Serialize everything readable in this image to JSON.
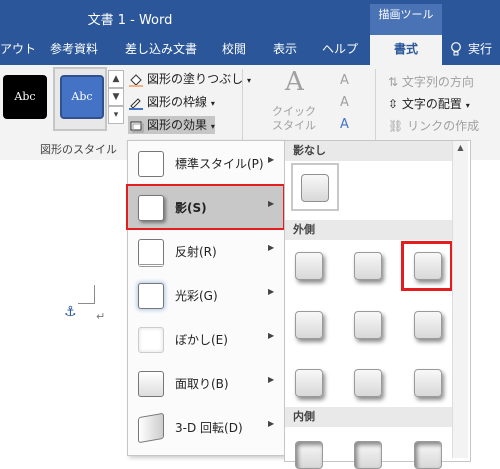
{
  "titlebar": {
    "title": "文書 1  -  Word",
    "tools_label": "描画ツール"
  },
  "tabs": [
    "アウト",
    "参考資料",
    "差し込み文書",
    "校閲",
    "表示",
    "ヘルプ",
    "書式",
    "実行"
  ],
  "ribbon": {
    "swatch_text": "Abc",
    "swatch_text2": "Abc",
    "cmd_fill": "図形の塗りつぶし",
    "cmd_outline": "図形の枠線",
    "cmd_effects": "図形の効果",
    "group_label": "図形のスタイル",
    "quick_style": "クイック\nスタイル",
    "text_direction": "文字列の方向",
    "text_align": "文字の配置",
    "create_link": "リンクの作成",
    "wordart_a": "A"
  },
  "menu": {
    "items": [
      {
        "label": "標準スタイル(P)"
      },
      {
        "label": "影(S)"
      },
      {
        "label": "反射(R)"
      },
      {
        "label": "光彩(G)"
      },
      {
        "label": "ぼかし(E)"
      },
      {
        "label": "面取り(B)"
      },
      {
        "label": "3-D 回転(D)"
      }
    ]
  },
  "gallery": {
    "none_header": "影なし",
    "outer_header": "外側",
    "inner_header": "内側"
  },
  "colors": {
    "brand": "#2b579a",
    "highlight": "#e41e1e"
  }
}
